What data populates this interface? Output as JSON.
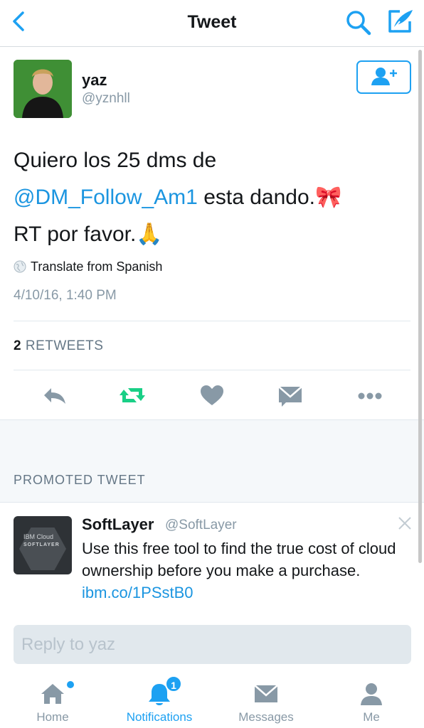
{
  "header": {
    "title": "Tweet",
    "icons": {
      "back": "chevron-left-icon",
      "search": "search-icon",
      "compose": "compose-icon"
    }
  },
  "tweet": {
    "author_name": "yaz",
    "author_handle": "@yznhll",
    "text_line1": "Quiero los 25 dms de",
    "mention": "@DM_Follow_Am1",
    "text_line2_rest": " esta dando.🎀",
    "text_line3": "RT por favor.🙏",
    "translate_label": "Translate from Spanish",
    "timestamp": "4/10/16, 1:40 PM",
    "retweet_count": "2",
    "retweet_label": " RETWEETS",
    "actions": [
      "reply-icon",
      "retweet-icon",
      "like-icon",
      "direct-message-icon",
      "more-icon"
    ]
  },
  "promoted": {
    "label": "PROMOTED TWEET",
    "logo_line1": "IBM Cloud",
    "logo_line2": "SOFTLAYER",
    "name": "SoftLayer",
    "handle": "@SoftLayer",
    "text": "Use this free tool to find the true cost of cloud ownership before you make a purchase. ",
    "link": "ibm.co/1PSstB0"
  },
  "reply": {
    "placeholder": "Reply to yaz"
  },
  "tabbar": {
    "tabs": [
      {
        "label": "Home",
        "icon": "home-icon"
      },
      {
        "label": "Notifications",
        "icon": "bell-icon",
        "badge": "1"
      },
      {
        "label": "Messages",
        "icon": "envelope-icon"
      },
      {
        "label": "Me",
        "icon": "person-icon"
      }
    ]
  },
  "colors": {
    "accent": "#1da1f2",
    "link": "#1b95e0",
    "retweet": "#19cf86",
    "muted": "#8899a6"
  }
}
